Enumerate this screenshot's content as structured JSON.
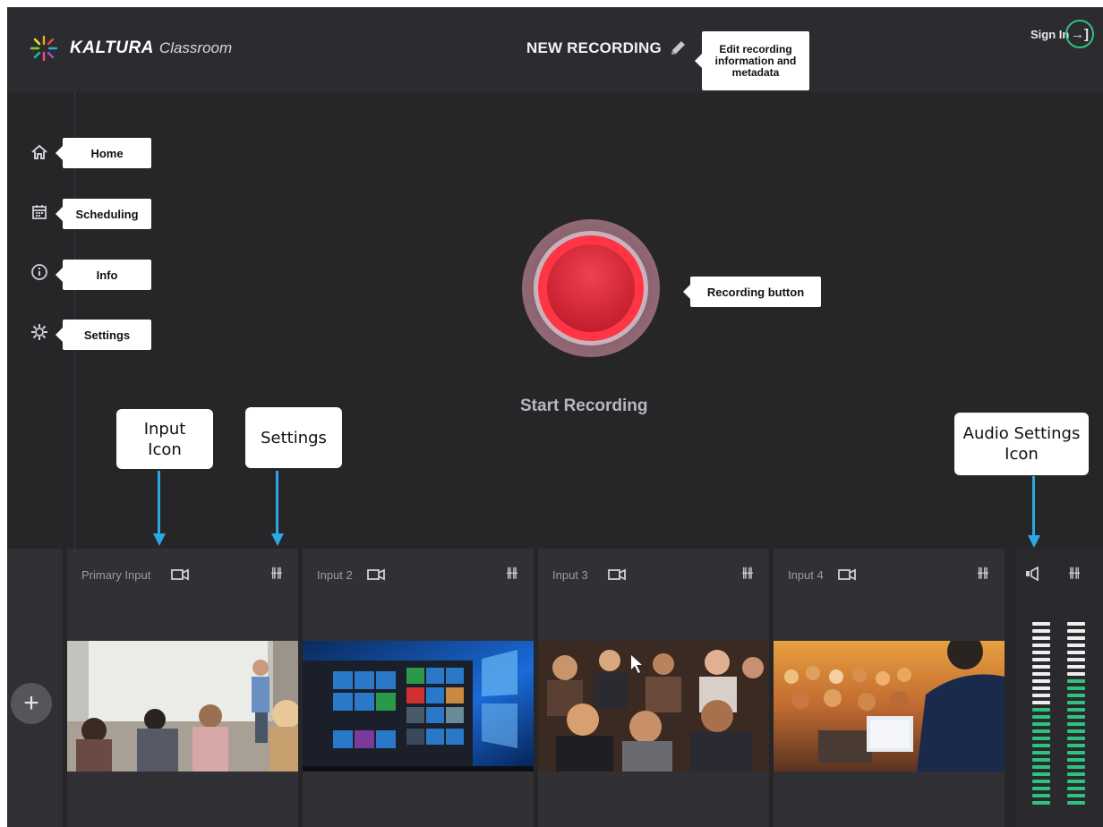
{
  "header": {
    "brand": "KALTURA",
    "brand_sub": "Classroom",
    "recording_title": "NEW RECORDING",
    "edit_callout": "Edit recording information and metadata",
    "sign_in": "Sign In",
    "sign_in_icon": "sign-in-icon"
  },
  "sidebar": {
    "items": [
      {
        "label": "Home",
        "icon": "home-icon"
      },
      {
        "label": "Scheduling",
        "icon": "calendar-icon"
      },
      {
        "label": "Info",
        "icon": "info-icon"
      },
      {
        "label": "Settings",
        "icon": "gear-icon"
      }
    ]
  },
  "recorder": {
    "button_callout": "Recording button",
    "start_label": "Start Recording"
  },
  "annotations": {
    "input_icon": "Input Icon",
    "settings": "Settings",
    "audio_settings_icon": "Audio Settings Icon"
  },
  "inputs": [
    {
      "name": "Primary Input",
      "icon": "camera-icon",
      "settings_icon": "sliders-icon",
      "preview": "classroom lecture"
    },
    {
      "name": "Input 2",
      "icon": "camera-icon",
      "settings_icon": "sliders-icon",
      "preview": "windows desktop"
    },
    {
      "name": "Input 3",
      "icon": "camera-icon",
      "settings_icon": "sliders-icon",
      "preview": "audience"
    },
    {
      "name": "Input 4",
      "icon": "camera-icon",
      "settings_icon": "sliders-icon",
      "preview": "conference"
    }
  ],
  "audio": {
    "speaker_icon": "speaker-icon",
    "settings_icon": "sliders-icon"
  },
  "colors": {
    "accent_green": "#2ec27e",
    "record_red": "#ff3545",
    "annotation_blue": "#2aa8e0",
    "background": "#262629"
  }
}
